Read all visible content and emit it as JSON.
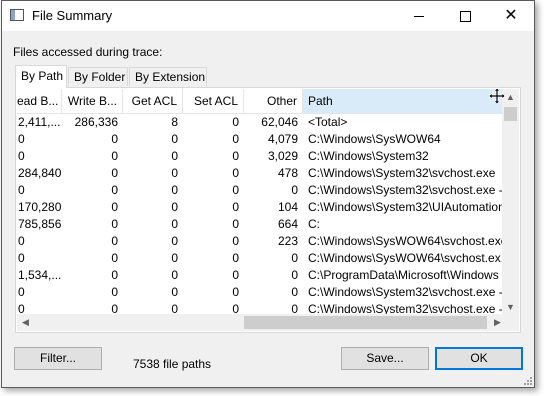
{
  "window": {
    "title": "File Summary",
    "icon": "window-icon",
    "controls": {
      "minimize": "minimize-icon",
      "maximize": "maximize-icon",
      "close": "✕"
    }
  },
  "caption": "Files accessed during trace:",
  "tabs": [
    {
      "label": "By Path",
      "active": true
    },
    {
      "label": "By Folder",
      "active": false
    },
    {
      "label": "By Extension",
      "active": false
    }
  ],
  "table": {
    "columns": [
      "ead B...",
      "Write B...",
      "Get ACL",
      "Set ACL",
      "Other",
      "Path"
    ],
    "rows": [
      [
        "2,411,...",
        "286,336",
        "8",
        "0",
        "62,046",
        "<Total>"
      ],
      [
        "0",
        "0",
        "0",
        "0",
        "4,079",
        "C:\\Windows\\SysWOW64"
      ],
      [
        "0",
        "0",
        "0",
        "0",
        "3,029",
        "C:\\Windows\\System32"
      ],
      [
        "284,840",
        "0",
        "0",
        "0",
        "478",
        "C:\\Windows\\System32\\svchost.exe"
      ],
      [
        "0",
        "0",
        "0",
        "0",
        "0",
        "C:\\Windows\\System32\\svchost.exe -k"
      ],
      [
        "170,280",
        "0",
        "0",
        "0",
        "104",
        "C:\\Windows\\System32\\UIAutomation..."
      ],
      [
        "785,856",
        "0",
        "0",
        "0",
        "664",
        "C:"
      ],
      [
        "0",
        "0",
        "0",
        "0",
        "223",
        "C:\\Windows\\SysWOW64\\svchost.exe"
      ],
      [
        "0",
        "0",
        "0",
        "0",
        "0",
        "C:\\Windows\\SysWOW64\\svchost.ex..."
      ],
      [
        "1,534,...",
        "0",
        "0",
        "0",
        "0",
        "C:\\ProgramData\\Microsoft\\Windows ..."
      ],
      [
        "0",
        "0",
        "0",
        "0",
        "0",
        "C:\\Windows\\System32\\svchost.exe -..."
      ],
      [
        "0",
        "0",
        "0",
        "0",
        "0",
        "C:\\Windows\\System32\\svchost.exe -..."
      ]
    ]
  },
  "buttons": {
    "filter": "Filter...",
    "save": "Save...",
    "ok": "OK"
  },
  "status": {
    "file_count": "7538 file paths"
  },
  "colors": {
    "accent": "#0078d7",
    "header_selected": "#d9ebf9",
    "window_bg": "#f0f0f0"
  }
}
